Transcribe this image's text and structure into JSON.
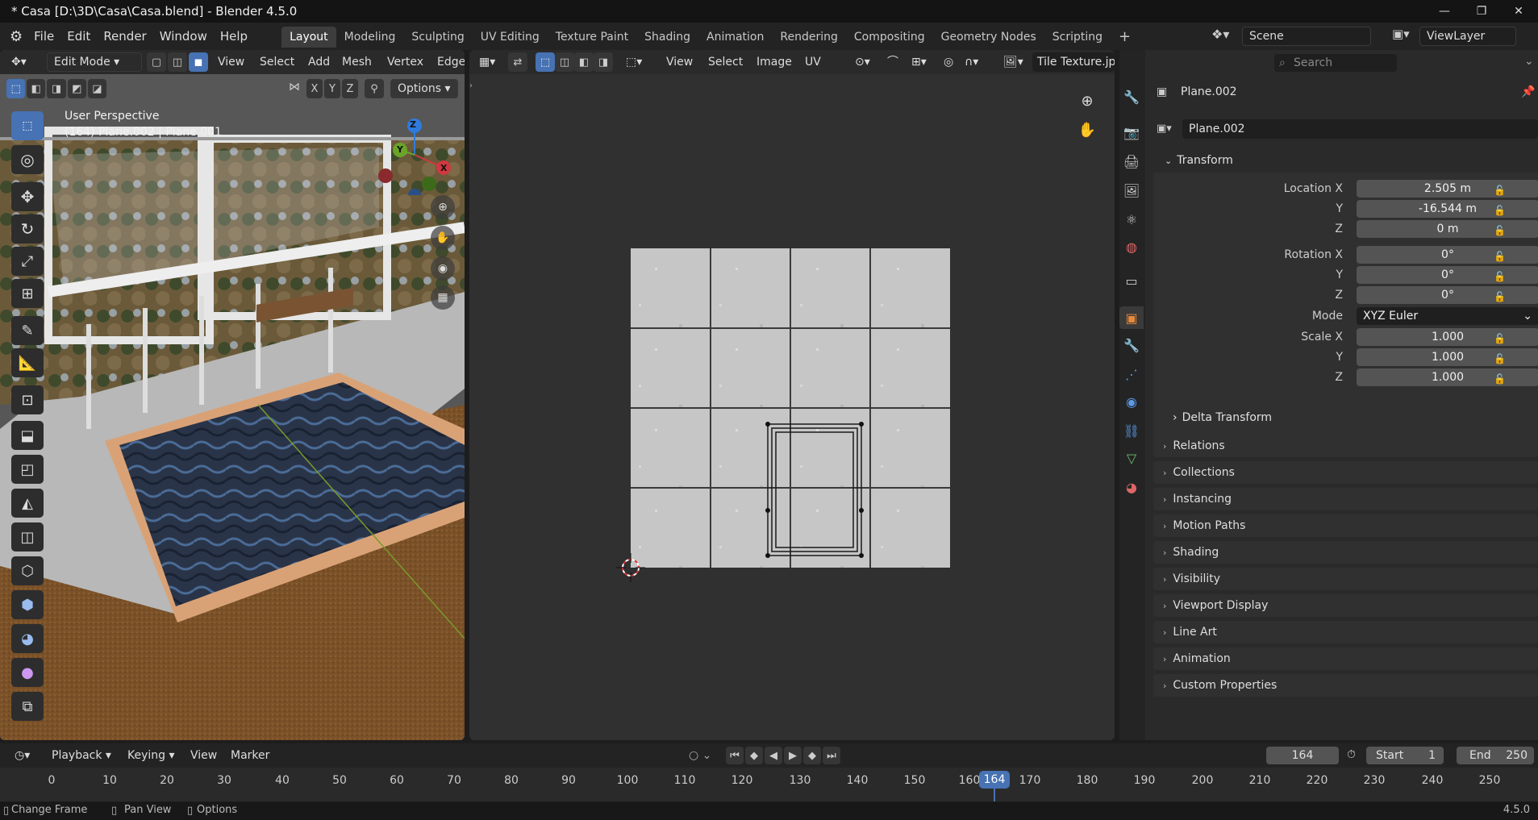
{
  "window": {
    "title": "* Casa [D:\\3D\\Casa\\Casa.blend] - Blender 4.5.0",
    "minimize": "—",
    "maximize": "❐",
    "close": "✕"
  },
  "menubar": {
    "items": [
      "File",
      "Edit",
      "Render",
      "Window",
      "Help"
    ],
    "workspaces": [
      "Layout",
      "Modeling",
      "Sculpting",
      "UV Editing",
      "Texture Paint",
      "Shading",
      "Animation",
      "Rendering",
      "Compositing",
      "Geometry Nodes",
      "Scripting"
    ],
    "active_workspace": "Layout",
    "add_tab": "+",
    "scene": "Scene",
    "view_layer": "ViewLayer"
  },
  "viewport": {
    "mode": "Edit Mode",
    "menus": [
      "View",
      "Select",
      "Add",
      "Mesh",
      "Vertex",
      "Edge"
    ],
    "axes": [
      "X",
      "Y",
      "Z"
    ],
    "options": "Options",
    "overlay_title": "User Perspective",
    "overlay_sub": "(164) Plane.002 | Plane.001",
    "gizmo": {
      "x": "X",
      "y": "Y",
      "z": "Z"
    }
  },
  "uv_editor": {
    "menus": [
      "View",
      "Select",
      "Image",
      "UV"
    ],
    "image_name": "Tile Texture.jp"
  },
  "properties": {
    "search_placeholder": "Search",
    "object_name": "Plane.002",
    "data_name": "Plane.002",
    "transform_label": "Transform",
    "rows": [
      {
        "label": "Location X",
        "value": "2.505 m"
      },
      {
        "label": "Y",
        "value": "-16.544 m"
      },
      {
        "label": "Z",
        "value": "0 m"
      },
      {
        "label": "Rotation X",
        "value": "0°"
      },
      {
        "label": "Y",
        "value": "0°"
      },
      {
        "label": "Z",
        "value": "0°"
      }
    ],
    "mode_label": "Mode",
    "mode_value": "XYZ Euler",
    "scale_rows": [
      {
        "label": "Scale X",
        "value": "1.000"
      },
      {
        "label": "Y",
        "value": "1.000"
      },
      {
        "label": "Z",
        "value": "1.000"
      }
    ],
    "delta": "Delta Transform",
    "panels": [
      "Relations",
      "Collections",
      "Instancing",
      "Motion Paths",
      "Shading",
      "Visibility",
      "Viewport Display",
      "Line Art",
      "Animation",
      "Custom Properties"
    ]
  },
  "timeline": {
    "menus": [
      "Playback",
      "Keying",
      "View",
      "Marker"
    ],
    "current_frame": "164",
    "start_label": "Start",
    "start": "1",
    "end_label": "End",
    "end": "250",
    "ticks": [
      "0",
      "10",
      "20",
      "30",
      "40",
      "50",
      "60",
      "70",
      "80",
      "90",
      "100",
      "110",
      "120",
      "130",
      "140",
      "150",
      "160",
      "164",
      "170",
      "180",
      "190",
      "200",
      "210",
      "220",
      "230",
      "240",
      "250"
    ]
  },
  "status": {
    "items": [
      "Change Frame",
      "Pan View",
      "Options"
    ],
    "version": "4.5.0"
  }
}
